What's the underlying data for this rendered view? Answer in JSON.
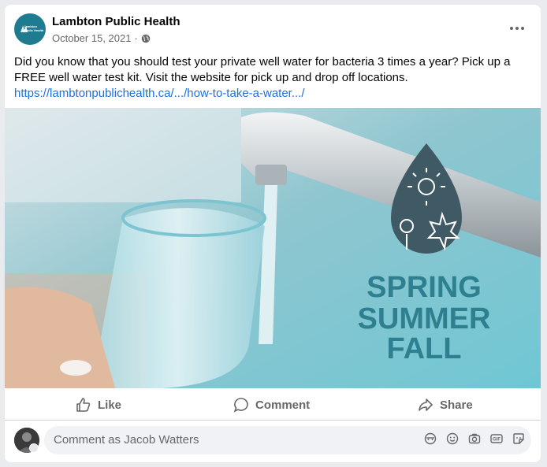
{
  "post": {
    "page_name": "Lambton Public Health",
    "avatar_text": "Lambton Public Health",
    "date": "October 15, 2021",
    "separator": "·",
    "privacy_icon": "globe-icon",
    "more_icon": "more-options-icon",
    "text": "Did you know that you should test your private well water for bacteria 3 times a year? Pick up a FREE well water test kit.  Visit the website for pick up and drop off locations.",
    "link": "https://lambtonpublichealth.ca/.../how-to-take-a-water.../"
  },
  "image": {
    "line1": "SPRING",
    "line2": "SUMMER",
    "line3": "FALL",
    "accent_color": "#2e7f8f",
    "drop_color": "#3f5965"
  },
  "actions": {
    "like_label": "Like",
    "comment_label": "Comment",
    "share_label": "Share"
  },
  "comment": {
    "placeholder": "Comment as Jacob Watters",
    "icons": [
      "avatar-sticker-icon",
      "emoji-icon",
      "camera-icon",
      "gif-icon",
      "sticker-icon"
    ]
  }
}
